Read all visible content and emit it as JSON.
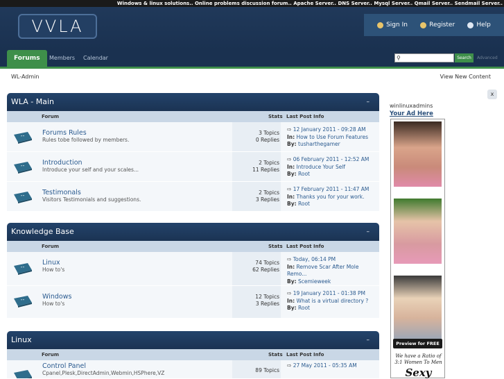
{
  "marquee_text": "Windows & linux solutions.. Online problems discussion forum.. Apache Server.. DNS Server.. Mysql Server.. Qmail Server.. Sendmail Server..",
  "logo_text": "VVLA",
  "user_links": {
    "sign_in": "Sign In",
    "register": "Register",
    "help": "Help"
  },
  "nav": {
    "forums": "Forums",
    "members": "Members",
    "calendar": "Calendar"
  },
  "search": {
    "placeholder": "",
    "button": "Search",
    "advanced": "Advanced"
  },
  "breadcrumb": "WL-Admin",
  "view_new_content": "View New Content",
  "close_label": "x",
  "columns": {
    "forum": "Forum",
    "stats": "Stats",
    "last_post": "Last Post Info"
  },
  "categories": [
    {
      "title": "WLA - Main",
      "forums": [
        {
          "name": "Forums Rules",
          "desc": "Rules tobe followed by members.",
          "topics": "3 Topics",
          "replies": "0 Replies",
          "date": "12 January 2011 - 09:28 AM",
          "in_label": "In:",
          "in": "How to Use Forum Features",
          "by_label": "By:",
          "by": "tusharthegamer"
        },
        {
          "name": "Introduction",
          "desc": "Introduce your self and your scales...",
          "topics": "2 Topics",
          "replies": "11 Replies",
          "date": "06 February 2011 - 12:52 AM",
          "in_label": "In:",
          "in": "Introduce Your Self",
          "by_label": "By:",
          "by": "Root"
        },
        {
          "name": "Testimonals",
          "desc": "Visitors Testimonials and suggestions.",
          "topics": "2 Topics",
          "replies": "3 Replies",
          "date": "17 February 2011 - 11:47 AM",
          "in_label": "In:",
          "in": "Thanks you for your work.",
          "by_label": "By:",
          "by": "Root"
        }
      ]
    },
    {
      "title": "Knowledge Base",
      "forums": [
        {
          "name": "Linux",
          "desc": "How to's",
          "topics": "74 Topics",
          "replies": "62 Replies",
          "date": "Today, 06:14 PM",
          "in_label": "In:",
          "in": "Remove Scar After Mole Remo...",
          "by_label": "By:",
          "by": "Scemieweek"
        },
        {
          "name": "Windows",
          "desc": "How to's",
          "topics": "12 Topics",
          "replies": "3 Replies",
          "date": "19 January 2011 - 01:38 PM",
          "in_label": "In:",
          "in": "What is a virtual directory ?",
          "by_label": "By:",
          "by": "Root"
        }
      ]
    },
    {
      "title": "Linux",
      "forums": [
        {
          "name": "Control Panel",
          "desc": "Cpanel,Plesk,DirectAdmin,Webmin,HSPhere,VZ",
          "topics": "89 Topics",
          "replies": "",
          "date": "27 May 2011 - 05:35 AM",
          "in_label": "In:",
          "in": "",
          "by_label": "By:",
          "by": ""
        }
      ]
    }
  ],
  "sidebar": {
    "title": "winlinuxadmins",
    "ad_link": "Your Ad Here",
    "preview_button": "Preview for FREE",
    "ad_text": "We have a Ratio of 3:1 Women To Men",
    "ad_big": "Sexy"
  },
  "colors": {
    "header": "#1d3553",
    "accent_green": "#3e8f4a",
    "link": "#2a5a8f"
  }
}
